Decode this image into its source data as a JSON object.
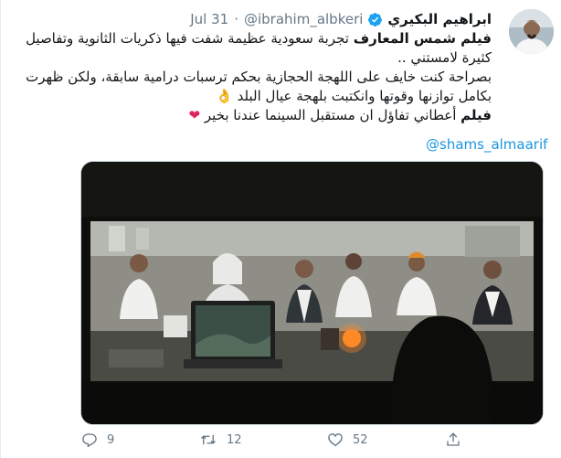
{
  "tweet": {
    "display_name": "ابراهيم البكيري",
    "handle": "@ibrahim_albkeri",
    "separator": "·",
    "date": "Jul 31",
    "lines": {
      "l1_bold": "فيلم شمس المعارف",
      "l1_rest": " تجربة سعودية عظيمة شفت فيها ذكريات الثانوية وتفاصيل",
      "l2": "كثيرة لامستني ..",
      "l3": "بصراحة كنت خايف على اللهجة الحجازية بحكم ترسبات درامية سابقة، ولكن ظهرت",
      "l4_text": "بكامل توازنها وقوتها وانكتبت بلهجة عيال البلد",
      "l4_emoji": "👌",
      "l5_bold": "فيلم",
      "l5_rest": " أعطاني تفاؤل ان مستقبل السينما عندنا بخير",
      "l5_emoji": "❤"
    },
    "link": "@shams_almaarif",
    "counts": {
      "replies": "9",
      "retweets": "12",
      "likes": "52"
    }
  },
  "colors": {
    "accent": "#1b95e0",
    "verified": "#1da1f2",
    "like": "#e0245e",
    "muted": "#657786"
  }
}
